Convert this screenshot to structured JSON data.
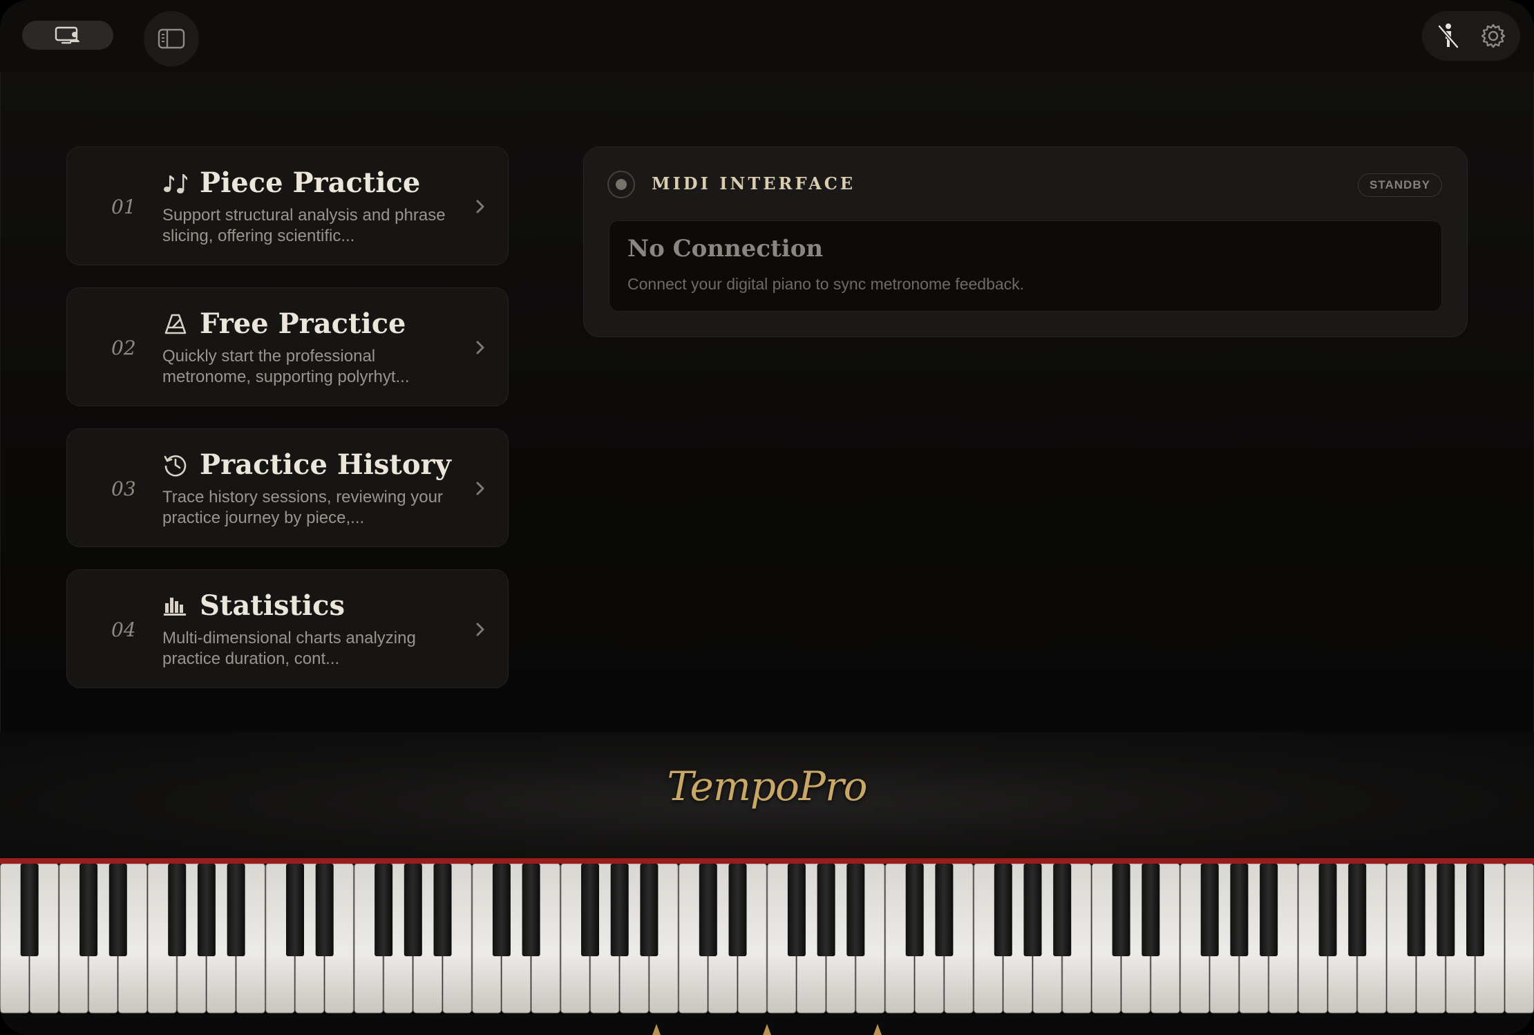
{
  "topbar": {
    "left_pill_icon": "display-person-icon",
    "sidebar_icon": "sidebar-toggle-icon",
    "right_icons": [
      "person-off-icon",
      "gear-icon"
    ]
  },
  "cards": [
    {
      "num": "01",
      "icon": "music-notes-icon",
      "title": "Piece Practice",
      "desc": "Support structural analysis and phrase slicing, offering scientific..."
    },
    {
      "num": "02",
      "icon": "metronome-icon",
      "title": "Free Practice",
      "desc": "Quickly start the professional metronome, supporting polyrhyt..."
    },
    {
      "num": "03",
      "icon": "history-icon",
      "title": "Practice History",
      "desc": "Trace history sessions, reviewing your practice journey by piece,..."
    },
    {
      "num": "04",
      "icon": "bar-chart-icon",
      "title": "Statistics",
      "desc": "Multi-dimensional charts analyzing practice duration, cont..."
    }
  ],
  "midi": {
    "title": "MIDI INTERFACE",
    "status": "STANDBY",
    "connection_title": "No Connection",
    "connection_subtitle": "Connect your digital piano to sync metronome feedback."
  },
  "brand": {
    "name": "TempoPro"
  },
  "colors": {
    "accent_gold": "#c9a766",
    "felt_red": "#9a1c1c",
    "card_bg": "#161514"
  }
}
